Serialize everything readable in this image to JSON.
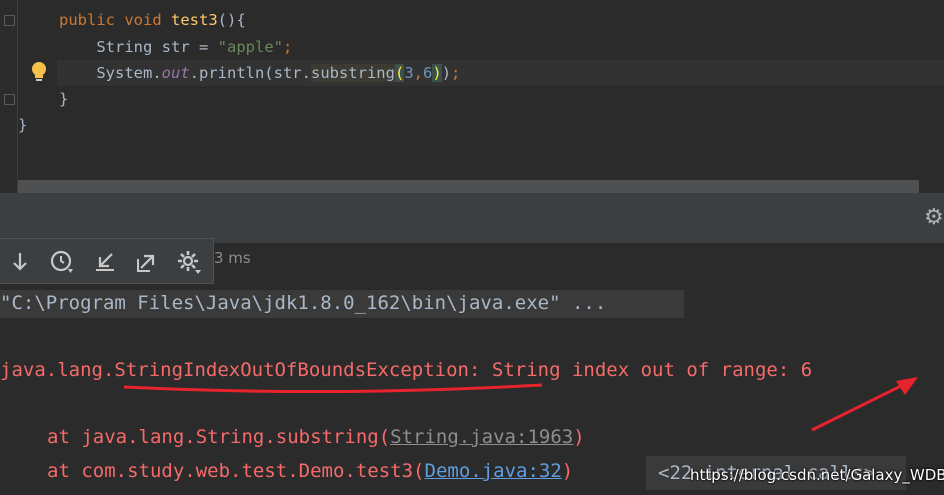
{
  "editor": {
    "lines": [
      {
        "indent": "",
        "parts": [
          {
            "cls": "kw",
            "text": "public "
          },
          {
            "cls": "kw",
            "text": "void "
          },
          {
            "cls": "fn",
            "text": "test3"
          },
          {
            "cls": "",
            "text": "(){"
          }
        ]
      },
      {
        "indent": "    ",
        "parts": [
          {
            "cls": "",
            "text": "String str = "
          },
          {
            "cls": "str",
            "text": "\"apple\""
          },
          {
            "cls": "kw",
            "text": ";"
          }
        ]
      },
      {
        "indent": "    ",
        "parts": [
          {
            "cls": "",
            "text": "System."
          },
          {
            "cls": "fld",
            "text": "out"
          },
          {
            "cls": "",
            "text": ".println(str."
          },
          {
            "cls": "method-hl",
            "text": "substring"
          },
          {
            "cls": "paren-hl",
            "text": "("
          },
          {
            "cls": "num",
            "text": "3"
          },
          {
            "cls": "kw",
            "text": ","
          },
          {
            "cls": "num",
            "text": "6"
          },
          {
            "cls": "paren-hl",
            "text": ")"
          },
          {
            "cls": "",
            "text": ")"
          },
          {
            "cls": "kw",
            "text": ";"
          }
        ]
      },
      {
        "indent": "",
        "parts": [
          {
            "cls": "",
            "text": "}"
          }
        ]
      },
      {
        "indent": "",
        "parts": [
          {
            "cls": "",
            "text": "}"
          }
        ]
      }
    ]
  },
  "run_panel": {
    "duration_fragment": "3 ms",
    "toolbar_icons": [
      "arrow-down-icon",
      "history-clock-icon",
      "import-arrow-icon",
      "export-arrow-icon",
      "settings-gear-icon"
    ]
  },
  "console": {
    "command": "\"C:\\Program Files\\Java\\jdk1.8.0_162\\bin\\java.exe\" ...",
    "exception_prefix": "java.lang.",
    "exception_class": "StringIndexOutOfBoundsException",
    "exception_message": ": String index out of range: 6",
    "trace1_prefix": "at java.lang.String.substring(",
    "trace1_link": "String.java:1963",
    "trace1_suffix": ")",
    "trace2_prefix": "at com.study.web.test.Demo.test3(",
    "trace2_link": "Demo.java:32",
    "trace2_suffix": ")",
    "internal_calls": "<22 internal calls>"
  },
  "watermark": "https://blog.csdn.net/Galaxy_WDB",
  "annotation_color": "#e8232b"
}
